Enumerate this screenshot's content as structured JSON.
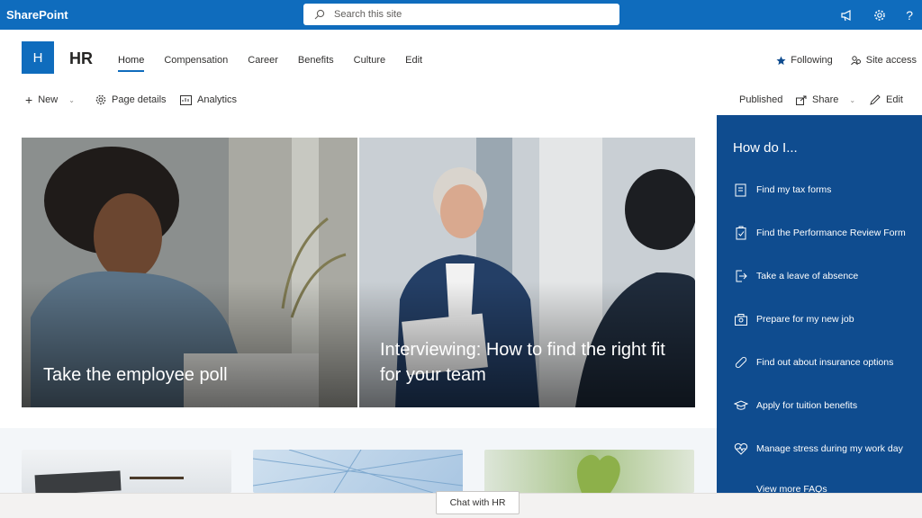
{
  "suite": {
    "brand": "SharePoint",
    "search_placeholder": "Search this site"
  },
  "site": {
    "logo_letter": "H",
    "title": "HR"
  },
  "nav": [
    "Home",
    "Compensation",
    "Career",
    "Benefits",
    "Culture",
    "Edit"
  ],
  "header_right": {
    "following": "Following",
    "site_access": "Site access"
  },
  "commands": {
    "new": "New",
    "page_details": "Page details",
    "analytics": "Analytics",
    "published": "Published",
    "share": "Share",
    "edit": "Edit"
  },
  "hero": {
    "tile1": "Take the employee poll",
    "tile2": "Interviewing: How to find the right fit for your team"
  },
  "panel": {
    "title": "How do I...",
    "links": [
      "Find my tax forms",
      "Find the Performance Review Form",
      "Take a leave of absence",
      "Prepare for my new job",
      "Find out about insurance options",
      "Apply for tuition benefits",
      "Manage stress during my work day"
    ],
    "more": "View more FAQs"
  },
  "chat": "Chat with HR",
  "colors": {
    "suite": "#0f6cbd",
    "panel": "#0f4c8f"
  }
}
